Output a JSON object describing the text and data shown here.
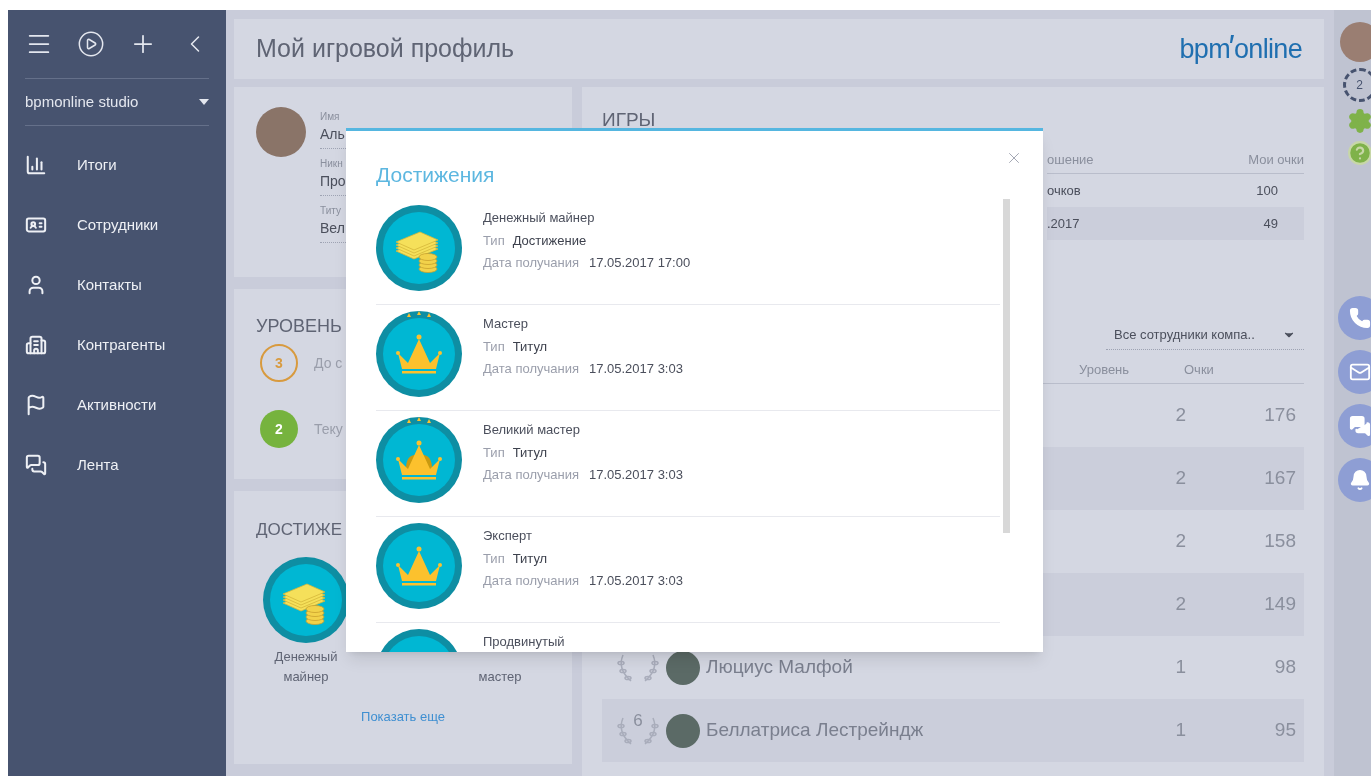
{
  "sidebar": {
    "workspace": "bpmonline studio",
    "items": [
      {
        "label": "Итоги",
        "kind": "chart"
      },
      {
        "label": "Сотрудники",
        "kind": "badge"
      },
      {
        "label": "Контакты",
        "kind": "person"
      },
      {
        "label": "Контрагенты",
        "kind": "building"
      },
      {
        "label": "Активности",
        "kind": "flag"
      },
      {
        "label": "Лента",
        "kind": "chat"
      }
    ]
  },
  "header": {
    "title": "Мой игровой профиль",
    "logo_left": "bpm",
    "logo_right": "online"
  },
  "profile": {
    "fields": [
      {
        "label": "Имя",
        "value": "Аль"
      },
      {
        "label": "Никн",
        "value": "Про"
      },
      {
        "label": "Титу",
        "value": "Вел"
      }
    ]
  },
  "level": {
    "title": "УРОВЕНЬ",
    "rows": [
      {
        "kind": "next",
        "number": "3",
        "text": "До с"
      },
      {
        "kind": "current",
        "number": "2",
        "text": "Теку"
      }
    ]
  },
  "achievements": {
    "title": "ДОСТИЖЕ",
    "badges": [
      {
        "kind": "money",
        "label": "Денежный майнер"
      },
      {
        "kind": "hidden",
        "label": "мастер"
      }
    ],
    "more_link": "Показать еще"
  },
  "games": {
    "title": "ИГРЫ",
    "columns": [
      "ошение",
      "Мои очки"
    ],
    "rows": [
      {
        "cells": [
          "очков",
          "100"
        ]
      },
      {
        "cells": [
          ".2017",
          "49"
        ]
      }
    ]
  },
  "leaderboard": {
    "filter": "Все сотрудники компа..",
    "columns": [
      "Уровень",
      "Очки"
    ],
    "rows": [
      {
        "level": "2",
        "points": "176"
      },
      {
        "level": "2",
        "points": "167"
      },
      {
        "level": "2",
        "points": "158"
      },
      {
        "level": "2",
        "points": "149"
      },
      {
        "name": "Люциус Малфой",
        "level": "1",
        "points": "98"
      },
      {
        "rank": "6",
        "name": "Беллатриса Лестрейндж",
        "level": "1",
        "points": "95"
      }
    ]
  },
  "right_bar": {
    "badge": "2"
  },
  "dialog": {
    "title": "Достижения",
    "items": [
      {
        "kind": "money",
        "title": "Денежный майнер",
        "type_label": "Тип",
        "type": "Достижение",
        "date_label": "Дата получания",
        "date": "17.05.2017 17:00"
      },
      {
        "kind": "crown-plus",
        "title": "Мастер",
        "type_label": "Тип",
        "type": "Титул",
        "date_label": "Дата получания",
        "date": "17.05.2017 3:03"
      },
      {
        "kind": "crown-grand",
        "title": "Великий мастер",
        "type_label": "Тип",
        "type": "Титул",
        "date_label": "Дата получания",
        "date": "17.05.2017 3:03"
      },
      {
        "kind": "crown",
        "title": "Эксперт",
        "type_label": "Тип",
        "type": "Титул",
        "date_label": "Дата получания",
        "date": "17.05.2017 3:03"
      },
      {
        "kind": "crown",
        "title": "Продвинутый"
      }
    ]
  }
}
